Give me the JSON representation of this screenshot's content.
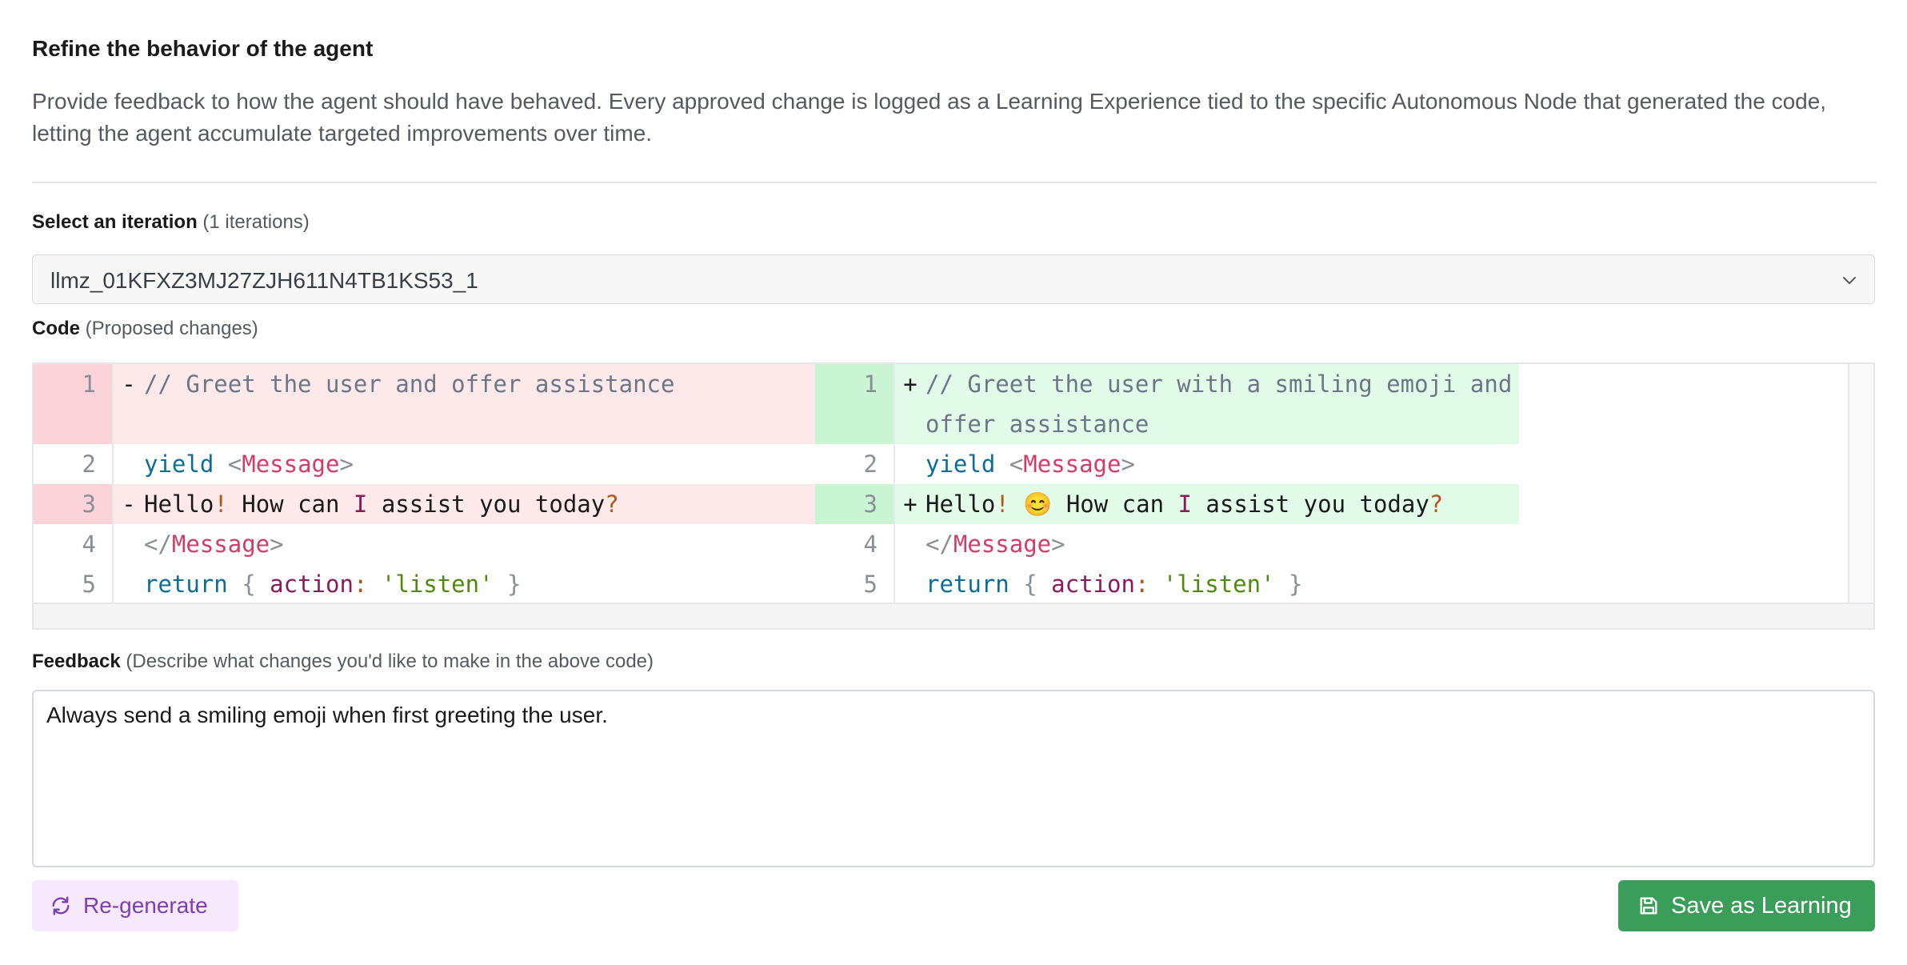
{
  "header": {
    "title": "Refine the behavior of the agent",
    "description": "Provide feedback to how the agent should have behaved. Every approved change is logged as a Learning Experience tied to the specific Autonomous Node that generated the code, letting the agent accumulate targeted improvements over time."
  },
  "iteration": {
    "label": "Select an iteration",
    "count_note": "(1 iterations)",
    "selected": "llmz_01KFXZ3MJ27ZJH611N4TB1KS53_1",
    "icon": "chevron-down-icon"
  },
  "code": {
    "label": "Code",
    "note": "(Proposed changes)",
    "left": [
      {
        "num": "1",
        "sign": "-",
        "type": "del"
      },
      {
        "num": "2",
        "sign": "",
        "type": "ctx"
      },
      {
        "num": "3",
        "sign": "-",
        "type": "del"
      },
      {
        "num": "4",
        "sign": "",
        "type": "ctx"
      },
      {
        "num": "5",
        "sign": "",
        "type": "ctx"
      }
    ],
    "right": [
      {
        "num": "1",
        "sign": "+",
        "type": "add"
      },
      {
        "num": "2",
        "sign": "",
        "type": "ctx"
      },
      {
        "num": "3",
        "sign": "+",
        "type": "add"
      },
      {
        "num": "4",
        "sign": "",
        "type": "ctx"
      },
      {
        "num": "5",
        "sign": "",
        "type": "ctx"
      }
    ],
    "tokens": {
      "l1": "// Greet the user and offer assistance",
      "r1": "// Greet the user with a smiling emoji and offer assistance",
      "yield": "yield",
      "lt": "<",
      "gt": ">",
      "close_open": "</",
      "message": "Message",
      "hello": "Hello",
      "bang": "!",
      "emoji": "😊",
      "how_can": " How can ",
      "i": "I",
      "assist": " assist you today",
      "q": "?",
      "return": "return",
      "brace_open": "{",
      "action": "action",
      "colon": ":",
      "listen": "'listen'",
      "brace_close": "}"
    }
  },
  "feedback": {
    "label": "Feedback",
    "note": "(Describe what changes you'd like to make in the above code)",
    "value": "Always send a smiling emoji when first greeting the user."
  },
  "actions": {
    "regenerate": "Re-generate",
    "regenerate_icon": "refresh-icon",
    "save": "Save as Learning",
    "save_icon": "save-icon"
  },
  "colors": {
    "accent_purple": "#7b3fb0",
    "save_green": "#3a9e5a",
    "del_bg": "#fde8ea",
    "add_bg": "#e2fbe8"
  }
}
